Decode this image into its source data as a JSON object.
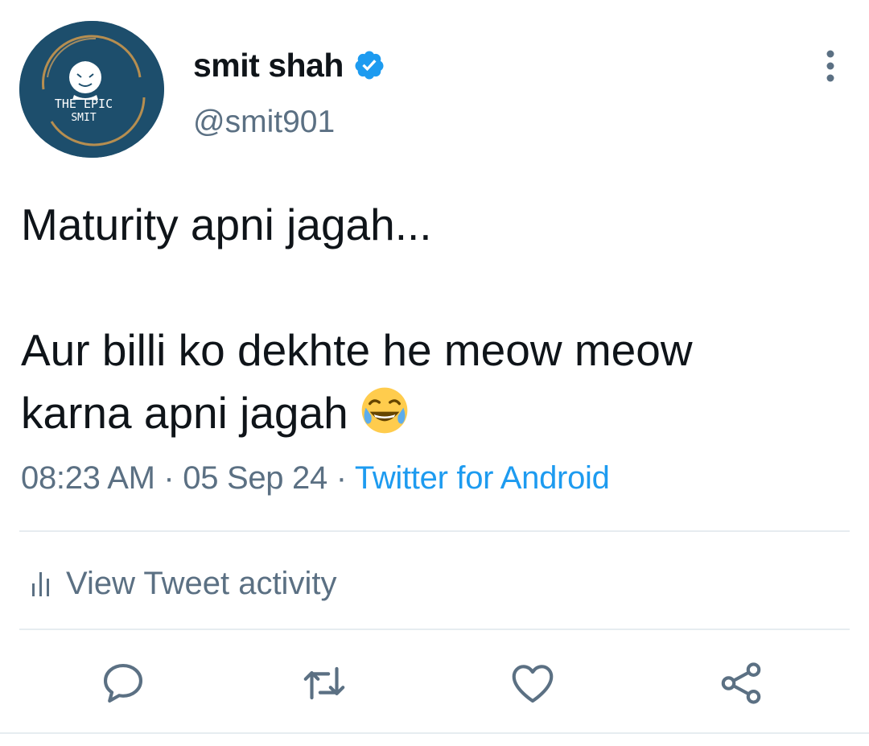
{
  "author": {
    "display_name": "smit shah",
    "handle": "@smit901",
    "avatar_text_line1": "THE EPIC",
    "avatar_text_line2": "SMIT",
    "verified_icon": "verified-badge-icon"
  },
  "tweet": {
    "text": "Maturity apni jagah...\n\nAur billi ko dekhte he meow meow\nkarna apni jagah ",
    "emoji": "face-with-tears-of-joy"
  },
  "meta": {
    "time": "08:23 AM",
    "separator": " · ",
    "date": "05 Sep 24",
    "source": "Twitter for Android"
  },
  "activity": {
    "label": "View Tweet activity",
    "icon": "bar-chart-icon"
  },
  "actions": {
    "reply_icon": "reply-icon",
    "retweet_icon": "retweet-icon",
    "like_icon": "heart-icon",
    "share_icon": "share-icon"
  },
  "colors": {
    "text": "#0f1419",
    "secondary": "#5b7083",
    "accent": "#1d9bf0",
    "divider": "#e6ecf0",
    "avatar_bg": "#1d4e6c"
  }
}
